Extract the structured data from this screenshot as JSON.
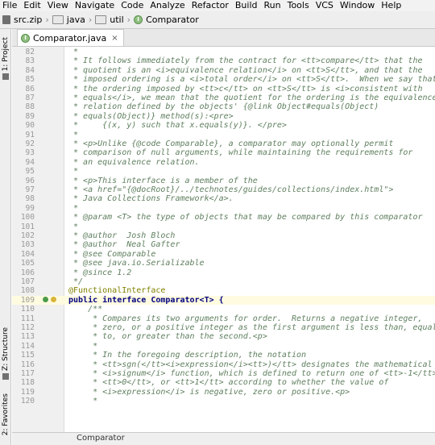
{
  "menu": [
    "File",
    "Edit",
    "View",
    "Navigate",
    "Code",
    "Analyze",
    "Refactor",
    "Build",
    "Run",
    "Tools",
    "VCS",
    "Window",
    "Help"
  ],
  "breadcrumbs": [
    "src.zip",
    "java",
    "util",
    "Comparator"
  ],
  "tab": {
    "label": "Comparator.java",
    "close": "×"
  },
  "sidebar": {
    "project": "1: Project",
    "structure": "Z: Structure",
    "favorites": "2: Favorites"
  },
  "status": {
    "label": "Comparator"
  },
  "lines": [
    {
      "n": "82",
      "t": " *"
    },
    {
      "n": "83",
      "t": " * It follows immediately from the contract for <tt>compare</tt> that the"
    },
    {
      "n": "84",
      "t": " * quotient is an <i>equivalence relation</i> on <tt>S</tt>, and that the"
    },
    {
      "n": "85",
      "t": " * imposed ordering is a <i>total order</i> on <tt>S</tt>.  When we say that"
    },
    {
      "n": "86",
      "t": " * the ordering imposed by <tt>c</tt> on <tt>S</tt> is <i>consistent with"
    },
    {
      "n": "87",
      "t": " * equals</i>, we mean that the quotient for the ordering is the equivalence"
    },
    {
      "n": "88",
      "t": " * relation defined by the objects' {@link Object#equals(Object)"
    },
    {
      "n": "89",
      "t": " * equals(Object)} method(s):<pre>"
    },
    {
      "n": "90",
      "t": " *     {(x, y) such that x.equals(y)}. </pre>"
    },
    {
      "n": "91",
      "t": " *"
    },
    {
      "n": "92",
      "t": " * <p>Unlike {@code Comparable}, a comparator may optionally permit"
    },
    {
      "n": "93",
      "t": " * comparison of null arguments, while maintaining the requirements for"
    },
    {
      "n": "94",
      "t": " * an equivalence relation."
    },
    {
      "n": "95",
      "t": " *"
    },
    {
      "n": "96",
      "t": " * <p>This interface is a member of the"
    },
    {
      "n": "97",
      "t": " * <a href=\"{@docRoot}/../technotes/guides/collections/index.html\">"
    },
    {
      "n": "98",
      "t": " * Java Collections Framework</a>."
    },
    {
      "n": "99",
      "t": " *"
    },
    {
      "n": "100",
      "t": " * @param <T> the type of objects that may be compared by this comparator"
    },
    {
      "n": "101",
      "t": " *"
    },
    {
      "n": "102",
      "t": " * @author  Josh Bloch"
    },
    {
      "n": "103",
      "t": " * @author  Neal Gafter"
    },
    {
      "n": "104",
      "t": " * @see Comparable"
    },
    {
      "n": "105",
      "t": " * @see java.io.Serializable"
    },
    {
      "n": "106",
      "t": " * @since 1.2"
    },
    {
      "n": "107",
      "t": " */"
    },
    {
      "n": "108",
      "t": "@FunctionalInterface"
    },
    {
      "n": "109",
      "t": "public interface Comparator<T> {"
    },
    {
      "n": "110",
      "t": "    /**"
    },
    {
      "n": "111",
      "t": "     * Compares its two arguments for order.  Returns a negative integer,"
    },
    {
      "n": "112",
      "t": "     * zero, or a positive integer as the first argument is less than, equal"
    },
    {
      "n": "113",
      "t": "     * to, or greater than the second.<p>"
    },
    {
      "n": "114",
      "t": "     *"
    },
    {
      "n": "115",
      "t": "     * In the foregoing description, the notation"
    },
    {
      "n": "116",
      "t": "     * <tt>sgn(</tt><i>expression</i><tt>)</tt> designates the mathematical"
    },
    {
      "n": "117",
      "t": "     * <i>signum</i> function, which is defined to return one of <tt>-1</tt>,"
    },
    {
      "n": "118",
      "t": "     * <tt>0</tt>, or <tt>1</tt> according to whether the value of"
    },
    {
      "n": "119",
      "t": "     * <i>expression</i> is negative, zero or positive.<p>"
    },
    {
      "n": "120",
      "t": "     *"
    }
  ]
}
